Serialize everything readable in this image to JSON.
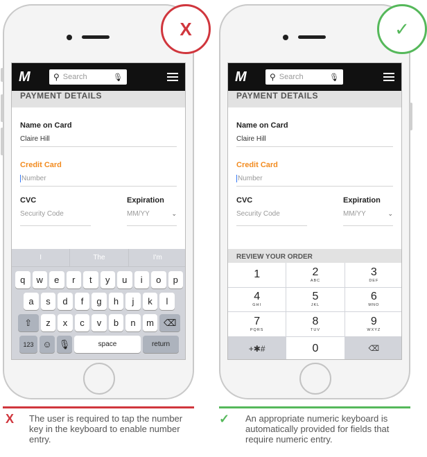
{
  "left": {
    "badge": "X",
    "navbar": {
      "logo": "M",
      "search_placeholder": "Search"
    },
    "section_title": "PAYMENT DETAILS",
    "name_label": "Name on Card",
    "name_value": "Claire Hill",
    "card_label": "Credit Card",
    "card_placeholder": "Number",
    "cvc_label": "CVC",
    "cvc_placeholder": "Security Code",
    "exp_label": "Expiration",
    "exp_placeholder": "MM/YY",
    "predictions": [
      "I",
      "The",
      "I'm"
    ],
    "row1": [
      "q",
      "w",
      "e",
      "r",
      "t",
      "y",
      "u",
      "i",
      "o",
      "p"
    ],
    "row2": [
      "a",
      "s",
      "d",
      "f",
      "g",
      "h",
      "j",
      "k",
      "l"
    ],
    "row3": [
      "z",
      "x",
      "c",
      "v",
      "b",
      "n",
      "m"
    ],
    "key_123": "123",
    "key_space": "space",
    "key_return": "return",
    "caption_mark": "X",
    "caption": "The user is required to tap the number key in the keyboard to enable number entry."
  },
  "right": {
    "badge": "✓",
    "navbar": {
      "logo": "M",
      "search_placeholder": "Search"
    },
    "section_title": "PAYMENT DETAILS",
    "name_label": "Name on Card",
    "name_value": "Claire Hill",
    "card_label": "Credit Card",
    "card_placeholder": "Number",
    "cvc_label": "CVC",
    "cvc_placeholder": "Security Code",
    "exp_label": "Expiration",
    "exp_placeholder": "MM/YY",
    "review_title": "REVIEW YOUR ORDER",
    "numpad": [
      {
        "d": "1",
        "l": ""
      },
      {
        "d": "2",
        "l": "ABC"
      },
      {
        "d": "3",
        "l": "DEF"
      },
      {
        "d": "4",
        "l": "GHI"
      },
      {
        "d": "5",
        "l": "JKL"
      },
      {
        "d": "6",
        "l": "MNO"
      },
      {
        "d": "7",
        "l": "PQRS"
      },
      {
        "d": "8",
        "l": "TUV"
      },
      {
        "d": "9",
        "l": "WXYZ"
      }
    ],
    "key_symbols": "+✱#",
    "key_zero": "0",
    "caption_mark": "✓",
    "caption": "An appropriate numeric keyboard is automatically provided for fields that require numeric entry."
  },
  "colors": {
    "bad": "#d0363d",
    "good": "#55b85a",
    "accent": "#f28b1f"
  }
}
